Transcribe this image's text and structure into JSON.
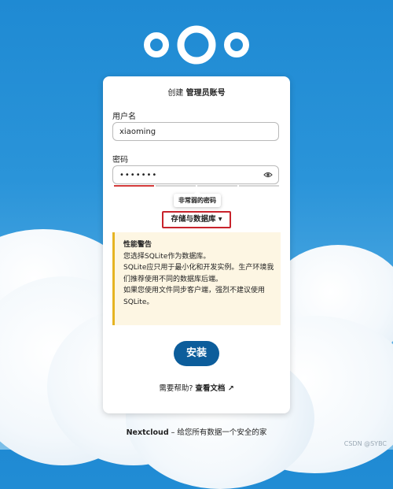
{
  "card": {
    "title_prefix": "创建",
    "title_bold": "管理员账号",
    "username_label": "用户名",
    "username_value": "xiaoming",
    "password_label": "密码",
    "password_value": "•••••••",
    "password_strength_text": "非常弱的密码",
    "storage_button": "存储与数据库 ▾",
    "warning": {
      "title": "性能警告",
      "line1": "您选择SQLite作为数据库。",
      "line2": "SQLite应只用于最小化和开发实例。生产环境我们推荐使用不同的数据库后端。",
      "line3": "如果您使用文件同步客户端，强烈不建议使用SQLite。"
    },
    "install_button": "安装",
    "help_prefix": "需要帮助?",
    "help_link": "查看文档 ↗"
  },
  "footer": {
    "brand": "Nextcloud",
    "tagline": " – 给您所有数据一个安全的家"
  },
  "watermark": "CSDN @SYBC",
  "colors": {
    "background": "#1f8ad3",
    "install_button": "#0c5d9b",
    "warning_border": "#e6b422",
    "strength_weak": "#d33b3b",
    "highlight_box": "#c8232c"
  },
  "icons": [
    "nextcloud-logo-icon",
    "eye-icon",
    "external-link-icon"
  ]
}
